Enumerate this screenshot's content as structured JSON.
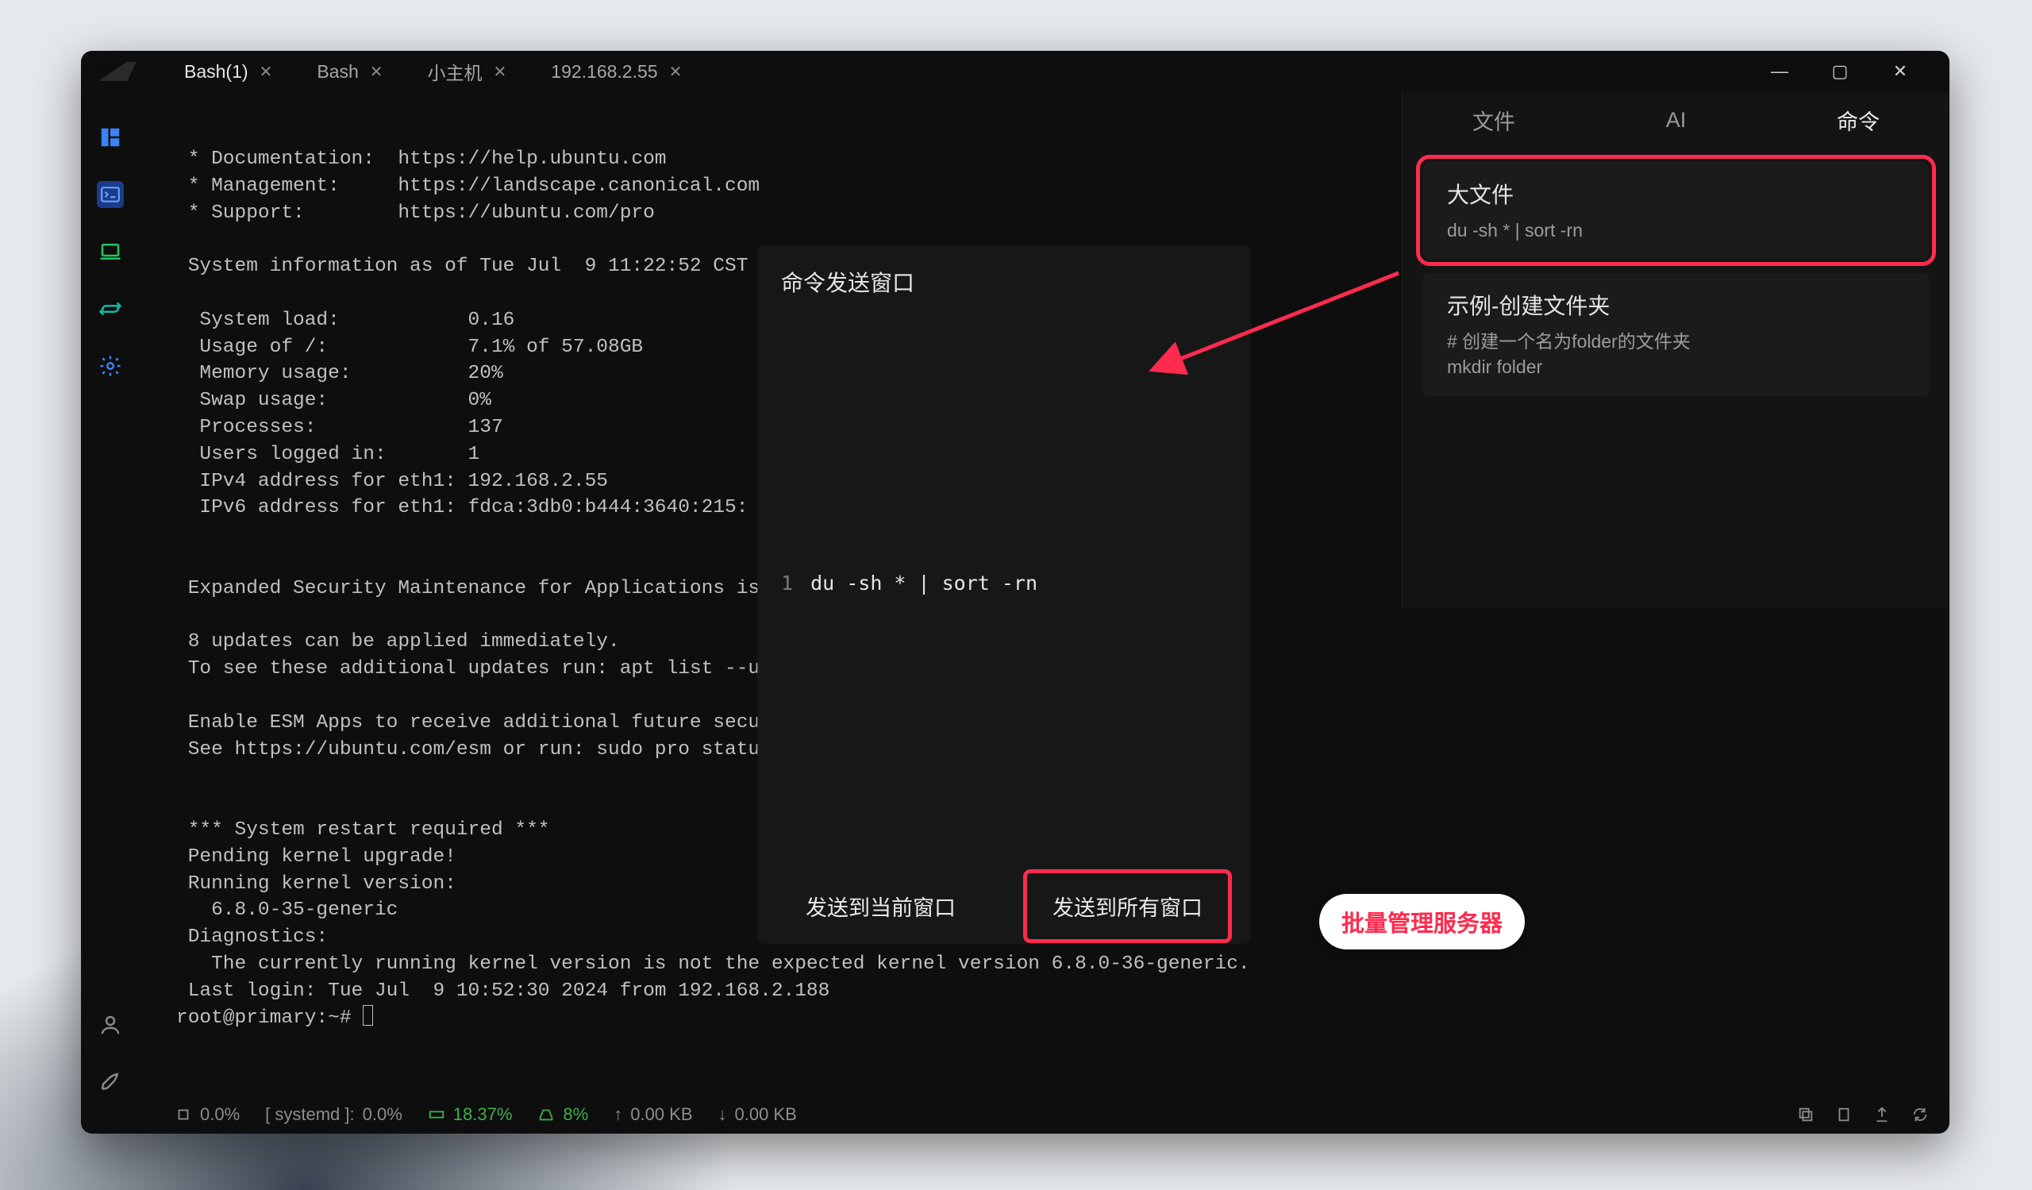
{
  "tabs": [
    {
      "label": "Bash(1)",
      "active": true
    },
    {
      "label": "Bash",
      "active": false
    },
    {
      "label": "小主机",
      "active": false
    },
    {
      "label": "192.168.2.55",
      "active": false
    }
  ],
  "window_controls": {
    "min": "—",
    "max": "▢",
    "close": "✕"
  },
  "terminal_text": " * Documentation:  https://help.ubuntu.com\n * Management:     https://landscape.canonical.com\n * Support:        https://ubuntu.com/pro\n\n System information as of Tue Jul  9 11:22:52 CST\n\n  System load:           0.16\n  Usage of /:            7.1% of 57.08GB\n  Memory usage:          20%\n  Swap usage:            0%\n  Processes:             137\n  Users logged in:       1\n  IPv4 address for eth1: 192.168.2.55\n  IPv6 address for eth1: fdca:3db0:b444:3640:215:\n\n\n Expanded Security Maintenance for Applications is\n\n 8 updates can be applied immediately.\n To see these additional updates run: apt list --u\n\n Enable ESM Apps to receive additional future secu\n See https://ubuntu.com/esm or run: sudo pro statu\n\n\n *** System restart required ***\n Pending kernel upgrade!\n Running kernel version:\n   6.8.0-35-generic\n Diagnostics:\n   The currently running kernel version is not the expected kernel version 6.8.0-36-generic.\n Last login: Tue Jul  9 10:52:30 2024 from 192.168.2.188",
  "prompt": "root@primary:~# ",
  "statusbar": {
    "cpu": "0.0%",
    "systemd_label": "[ systemd ]:",
    "systemd": "0.0%",
    "mem": "18.37%",
    "disk": "8%",
    "up": "0.00 KB",
    "down": "0.00 KB"
  },
  "side_tabs": {
    "file": "文件",
    "ai": "AI",
    "cmd": "命令"
  },
  "side_cmds": [
    {
      "title": "大文件",
      "sub": "du -sh  * | sort -rn"
    },
    {
      "title": "示例-创建文件夹",
      "sub": "# 创建一个名为folder的文件夹\nmkdir folder"
    }
  ],
  "dialog": {
    "title": "命令发送窗口",
    "line_no": "1",
    "code": "du -sh  * | sort -rn",
    "send_current": "发送到当前窗口",
    "send_all": "发送到所有窗口"
  },
  "bubble_label": "批量管理服务器"
}
